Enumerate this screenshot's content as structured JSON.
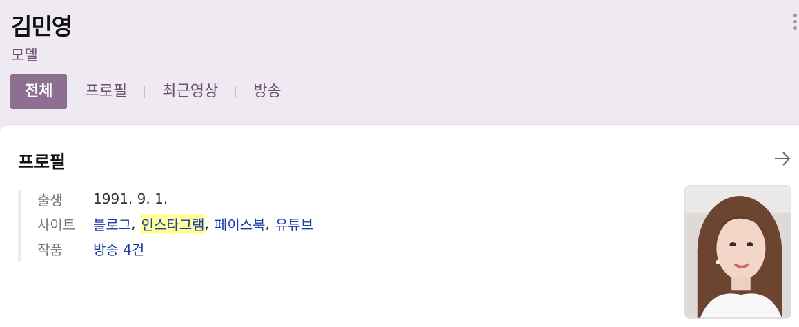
{
  "person": {
    "name": "김민영",
    "job": "모델"
  },
  "tabs": [
    {
      "label": "전체"
    },
    {
      "label": "프로필"
    },
    {
      "label": "최근영상"
    },
    {
      "label": "방송"
    }
  ],
  "profile": {
    "title": "프로필",
    "birth": {
      "label": "출생",
      "value": "1991. 9. 1."
    },
    "site": {
      "label": "사이트",
      "links": [
        "블로그",
        "인스타그램",
        "페이스북",
        "유튜브"
      ],
      "separator": ","
    },
    "works": {
      "label": "작품",
      "value": "방송 4건"
    }
  },
  "colors": {
    "accent": "#8d708f",
    "link": "#1a3da8",
    "highlight": "#ffff9e"
  }
}
